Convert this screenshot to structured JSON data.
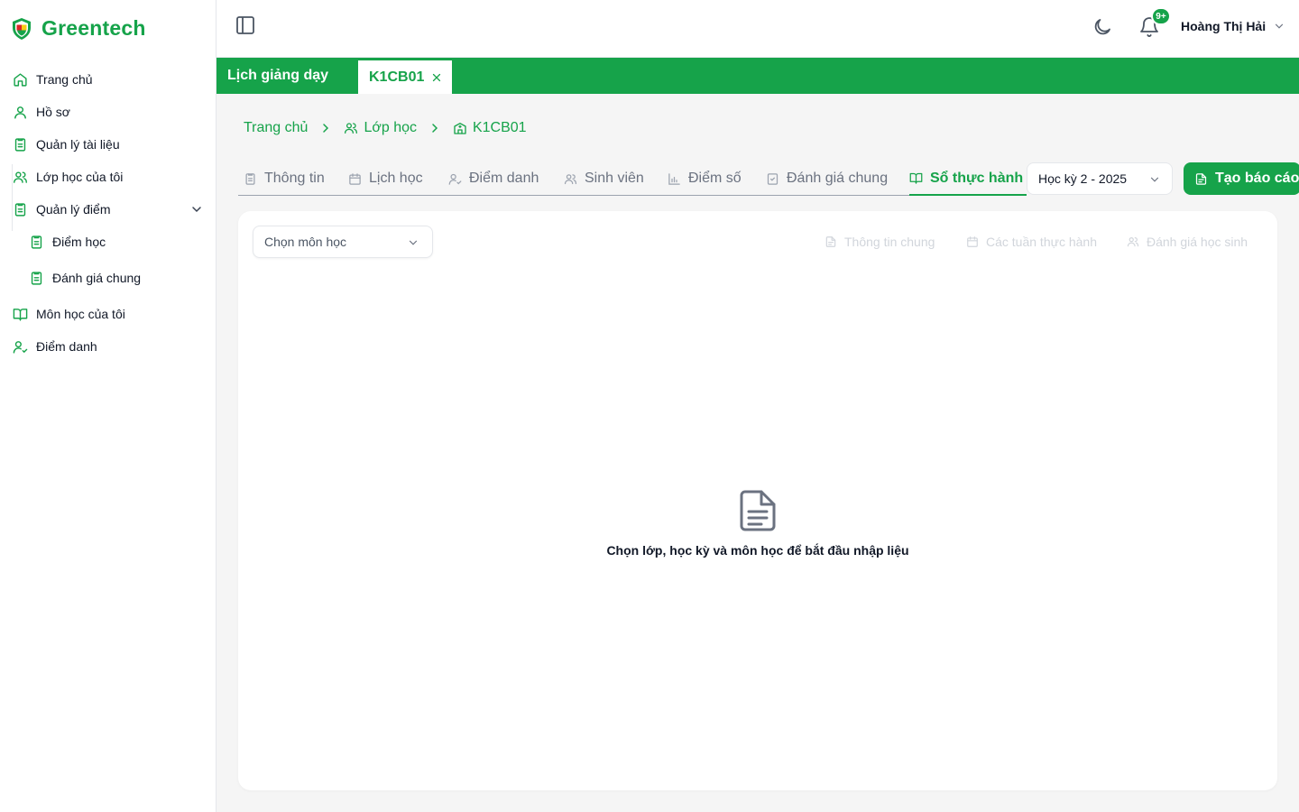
{
  "brand": {
    "name": "Greentech",
    "logo_icon": "shield-logo-icon"
  },
  "sidebar": {
    "items": [
      {
        "label": "Trang chủ",
        "icon": "home-icon"
      },
      {
        "label": "Hồ sơ",
        "icon": "user-icon"
      },
      {
        "label": "Quản lý tài liệu",
        "icon": "document-icon"
      },
      {
        "label": "Lớp học của tôi",
        "icon": "users-icon"
      },
      {
        "label": "Quản lý điểm",
        "icon": "clipboard-icon",
        "expanded": true
      },
      {
        "label": "Điểm học",
        "icon": "clipboard-icon",
        "sub": true
      },
      {
        "label": "Đánh giá chung",
        "icon": "clipboard-icon",
        "sub": true
      },
      {
        "label": "Môn học của tôi",
        "icon": "book-open-icon"
      },
      {
        "label": "Điểm danh",
        "icon": "user-check-icon"
      }
    ]
  },
  "header": {
    "notification_badge": "9+",
    "user_name": "Hoàng Thị Hải"
  },
  "page_tabs": {
    "main_label": "Lịch giảng dạy",
    "active_label": "K1CB01"
  },
  "breadcrumb": {
    "home": "Trang chủ",
    "classes": "Lớp học",
    "current": "K1CB01"
  },
  "section_tabs": [
    {
      "label": "Thông tin",
      "icon": "clipboard-icon"
    },
    {
      "label": "Lịch học",
      "icon": "calendar-icon"
    },
    {
      "label": "Điểm danh",
      "icon": "user-check-icon"
    },
    {
      "label": "Sinh viên",
      "icon": "users-icon"
    },
    {
      "label": "Điểm số",
      "icon": "bar-chart-icon"
    },
    {
      "label": "Đánh giá chung",
      "icon": "check-square-icon"
    },
    {
      "label": "Sổ thực hành",
      "icon": "book-open-icon",
      "active": true
    }
  ],
  "semester_select": {
    "value": "Học kỳ 2 - 2025"
  },
  "report_button": {
    "label": "Tạo báo cáo"
  },
  "subject_select": {
    "placeholder": "Chọn môn học"
  },
  "sub_tabs": [
    {
      "label": "Thông tin chung",
      "icon": "file-icon"
    },
    {
      "label": "Các tuần thực hành",
      "icon": "calendar-icon"
    },
    {
      "label": "Đánh giá học sinh",
      "icon": "users-icon"
    }
  ],
  "empty_state": {
    "message": "Chọn lớp, học kỳ và môn học để bắt đầu nhập liệu"
  },
  "colors": {
    "accent": "#16a34a",
    "background": "#f5f5f5",
    "muted": "#6b7280"
  }
}
